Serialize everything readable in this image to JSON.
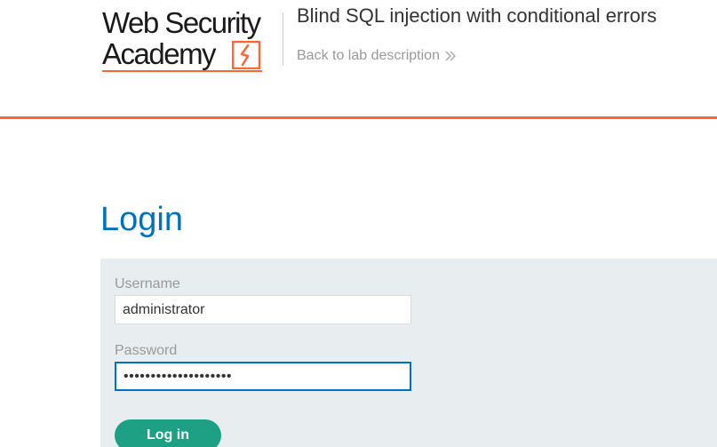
{
  "header": {
    "logo": {
      "line1": "Web Security",
      "line2": "Academy",
      "accent_color": "#ff6633"
    },
    "lab_title": "Blind SQL injection with conditional errors",
    "back_link": {
      "label": "Back to lab description",
      "icon": "double-chevron-right-icon"
    }
  },
  "main": {
    "heading": "Login",
    "form": {
      "username": {
        "label": "Username",
        "value": "administrator"
      },
      "password": {
        "label": "Password",
        "value": "••••••••••••••••••••"
      },
      "submit_label": "Log in"
    }
  },
  "colors": {
    "accent": "#ff6633",
    "heading_blue": "#0071bc",
    "button_green": "#1ea085",
    "panel_bg": "#e8eef0"
  }
}
